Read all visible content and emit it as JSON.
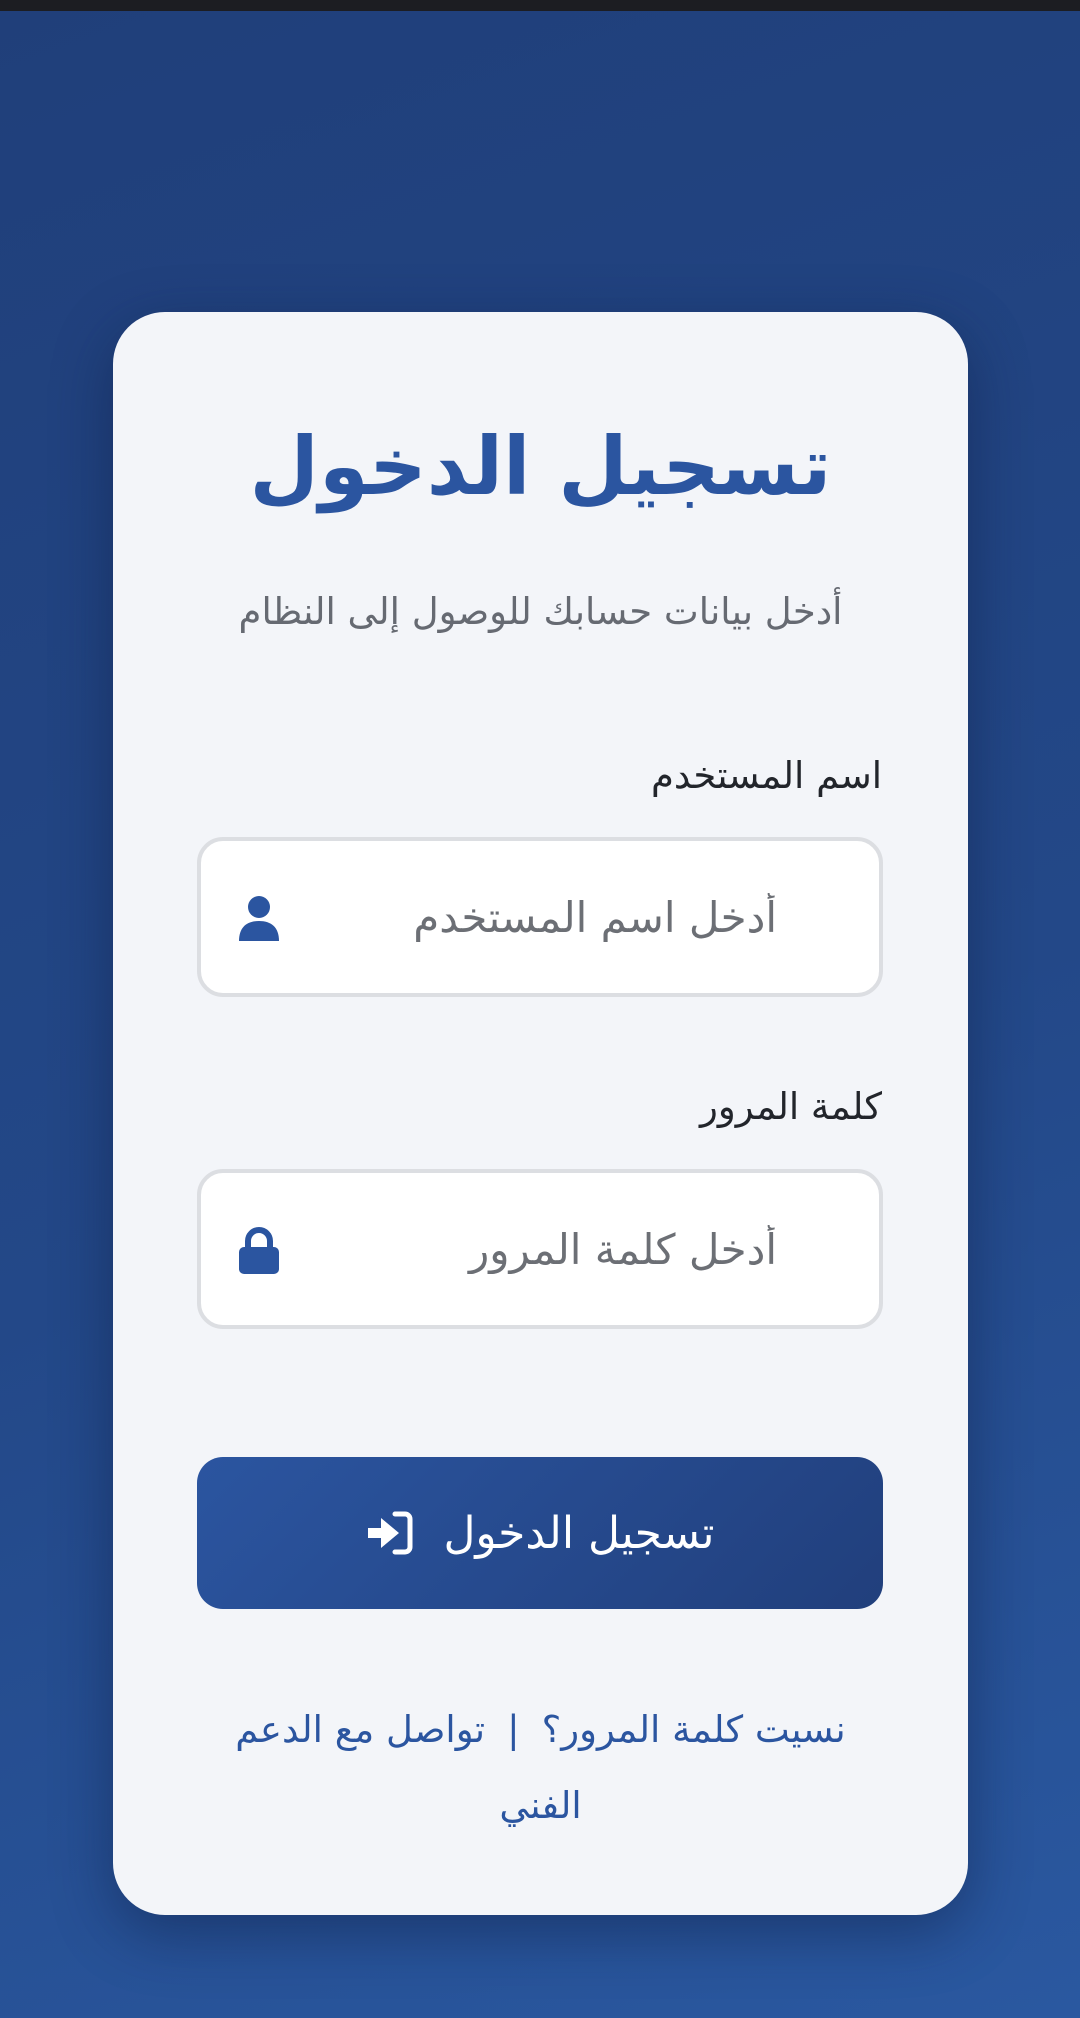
{
  "login": {
    "title": "تسجيل الدخول",
    "subtitle": "أدخل بيانات حسابك للوصول إلى النظام",
    "username": {
      "label": "اسم المستخدم",
      "placeholder": "أدخل اسم المستخدم",
      "value": "",
      "icon": "user-icon"
    },
    "password": {
      "label": "كلمة المرور",
      "placeholder": "أدخل كلمة المرور",
      "value": "",
      "icon": "lock-icon"
    },
    "submit": {
      "label": "تسجيل الدخول",
      "icon": "sign-in-icon"
    },
    "links": {
      "forgot_password": "نسيت كلمة المرور؟",
      "separator": "|",
      "contact_support": "تواصل مع الدعم الفني"
    }
  },
  "colors": {
    "primary": "#2b55a0",
    "background": "#234888",
    "card": "#f3f5f9"
  }
}
